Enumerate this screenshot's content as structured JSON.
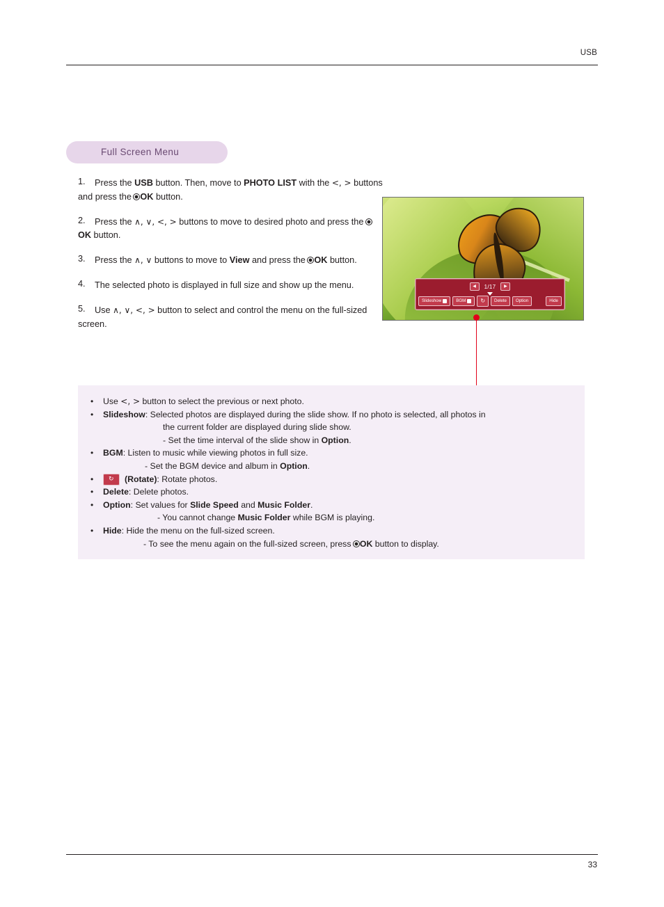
{
  "header": {
    "label": "USB"
  },
  "footer": {
    "page_number": "33"
  },
  "section": {
    "title": "Full Screen Menu"
  },
  "steps": [
    {
      "num": "1.",
      "html": "Press the <b>USB</b> button. Then, move to <b>PHOTO LIST</b> with the <span class=\"glyph\">&#60;, &#62;</span> buttons and press the <span class=\"okdot\"></span><span class=\"ok\">OK</span> button."
    },
    {
      "num": "2.",
      "html": "Press the <span class=\"glyph\">&#8743;, &#8744;, &#60;, &#62;</span> buttons to move to desired photo and press the <span class=\"okdot\"></span><span class=\"ok\">OK</span> button."
    },
    {
      "num": "3.",
      "html": "Press the <span class=\"glyph\">&#8743;, &#8744;</span> buttons to move to <b>View</b> and press the <span class=\"okdot\"></span><span class=\"ok\">OK</span> button."
    },
    {
      "num": "4.",
      "html": "The selected photo is displayed in full size and show up the menu."
    },
    {
      "num": "5.",
      "html": "Use <span class=\"glyph\">&#8743;, &#8744;, &#60;, &#62;</span> button to select and control the menu on the full-sized screen."
    }
  ],
  "osd": {
    "prev_arrow": "◀",
    "next_arrow": "▶",
    "counter": "1/17",
    "buttons": [
      {
        "label": "Slideshow",
        "icon": "square-icon"
      },
      {
        "label": "BGM",
        "icon": "square-icon"
      },
      {
        "label": "",
        "icon": "rotate-icon"
      },
      {
        "label": "Delete",
        "icon": ""
      },
      {
        "label": "Option",
        "icon": ""
      },
      {
        "label": "Hide",
        "icon": ""
      }
    ]
  },
  "notes": [
    {
      "bullet": "•",
      "html": "Use <span class=\"glyph\">&#60;, &#62;</span> button to select the previous or next photo."
    },
    {
      "bullet": "•",
      "html": "<b>Slideshow</b>: Selected photos are displayed during the slide show. If no photo is selected, all photos in<span class=\"sub\" style=\"margin-left:86px\">the current folder are displayed during slide show.</span><span class=\"sub\" style=\"margin-left:86px\">- Set the time interval of the slide show in <b>Option</b>.</span>"
    },
    {
      "bullet": "•",
      "html": "<b>BGM</b>: Listen to music while viewing photos in full size.<span class=\"sub\" style=\"margin-left:60px\">- Set the BGM device and album in <b>Option</b>.</span>"
    },
    {
      "bullet": "•",
      "html": "<span class=\"rot-chip\">&#8635;</span> <b>(Rotate)</b>: Rotate photos."
    },
    {
      "bullet": "•",
      "html": "<b>Delete</b>: Delete photos."
    },
    {
      "bullet": "•",
      "html": "<b>Option</b>: Set values for <b>Slide Speed</b> and <b>Music Folder</b>.<span class=\"sub\" style=\"margin-left:78px\">- You cannot change <b>Music Folder</b> while BGM is playing.</span>"
    },
    {
      "bullet": "•",
      "html": "<b>Hide</b>: Hide the menu on the full-sized screen.<span class=\"sub\" style=\"margin-left:58px\">- To see the menu again on the full-sized screen, press <span class=\"okdot\"></span><span class=\"ok\">OK</span> button to display.</span>"
    }
  ],
  "colors": {
    "accent_pill": "#e7d6ea",
    "pill_text": "#6a4a72",
    "notes_bg": "#f5eef7",
    "callout": "#e2001a",
    "osd_bg": "#9b1c2e"
  }
}
